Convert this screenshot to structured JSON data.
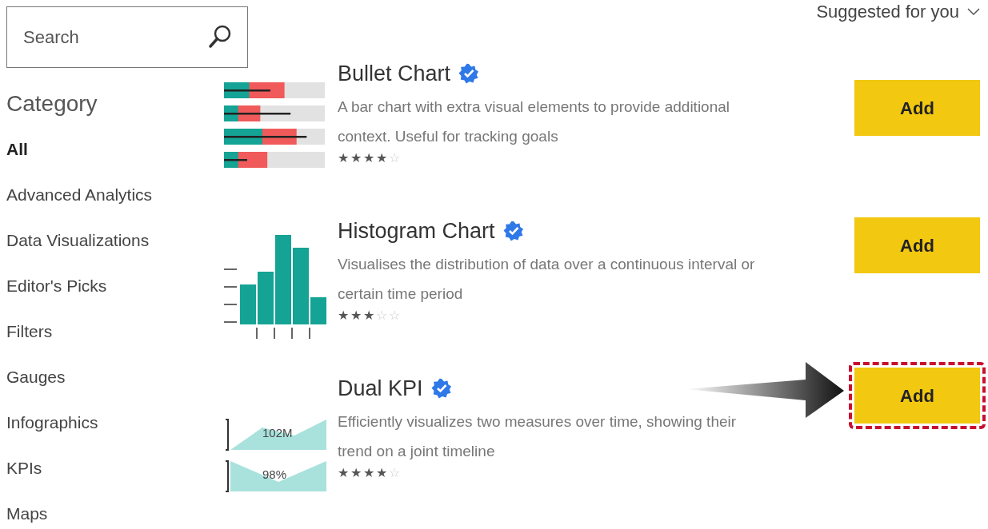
{
  "search": {
    "placeholder": "Search"
  },
  "sort": {
    "label": "Suggested for you"
  },
  "category": {
    "heading": "Category",
    "items": [
      {
        "label": "All",
        "selected": true
      },
      {
        "label": "Advanced Analytics",
        "selected": false
      },
      {
        "label": "Data Visualizations",
        "selected": false
      },
      {
        "label": "Editor's Picks",
        "selected": false
      },
      {
        "label": "Filters",
        "selected": false
      },
      {
        "label": "Gauges",
        "selected": false
      },
      {
        "label": "Infographics",
        "selected": false
      },
      {
        "label": "KPIs",
        "selected": false
      },
      {
        "label": "Maps",
        "selected": false
      }
    ]
  },
  "visuals": [
    {
      "title": "Bullet Chart",
      "verified": true,
      "description": "A bar chart with extra visual elements to provide additional context. Useful for tracking goals",
      "stars": 4,
      "thumbnail": {
        "kind": "bullet"
      },
      "button": "Add",
      "highlighted": false
    },
    {
      "title": "Histogram Chart",
      "verified": true,
      "description": "Visualises the distribution of data over a continuous interval or certain time period",
      "stars": 3,
      "thumbnail": {
        "kind": "histogram"
      },
      "button": "Add",
      "highlighted": false
    },
    {
      "title": "Dual KPI",
      "verified": true,
      "description": "Efficiently visualizes two measures over time, showing their trend on a joint timeline",
      "stars": 4,
      "thumbnail": {
        "kind": "kpi",
        "labels": [
          "102M",
          "98%"
        ]
      },
      "button": "Add",
      "highlighted": true
    }
  ]
}
